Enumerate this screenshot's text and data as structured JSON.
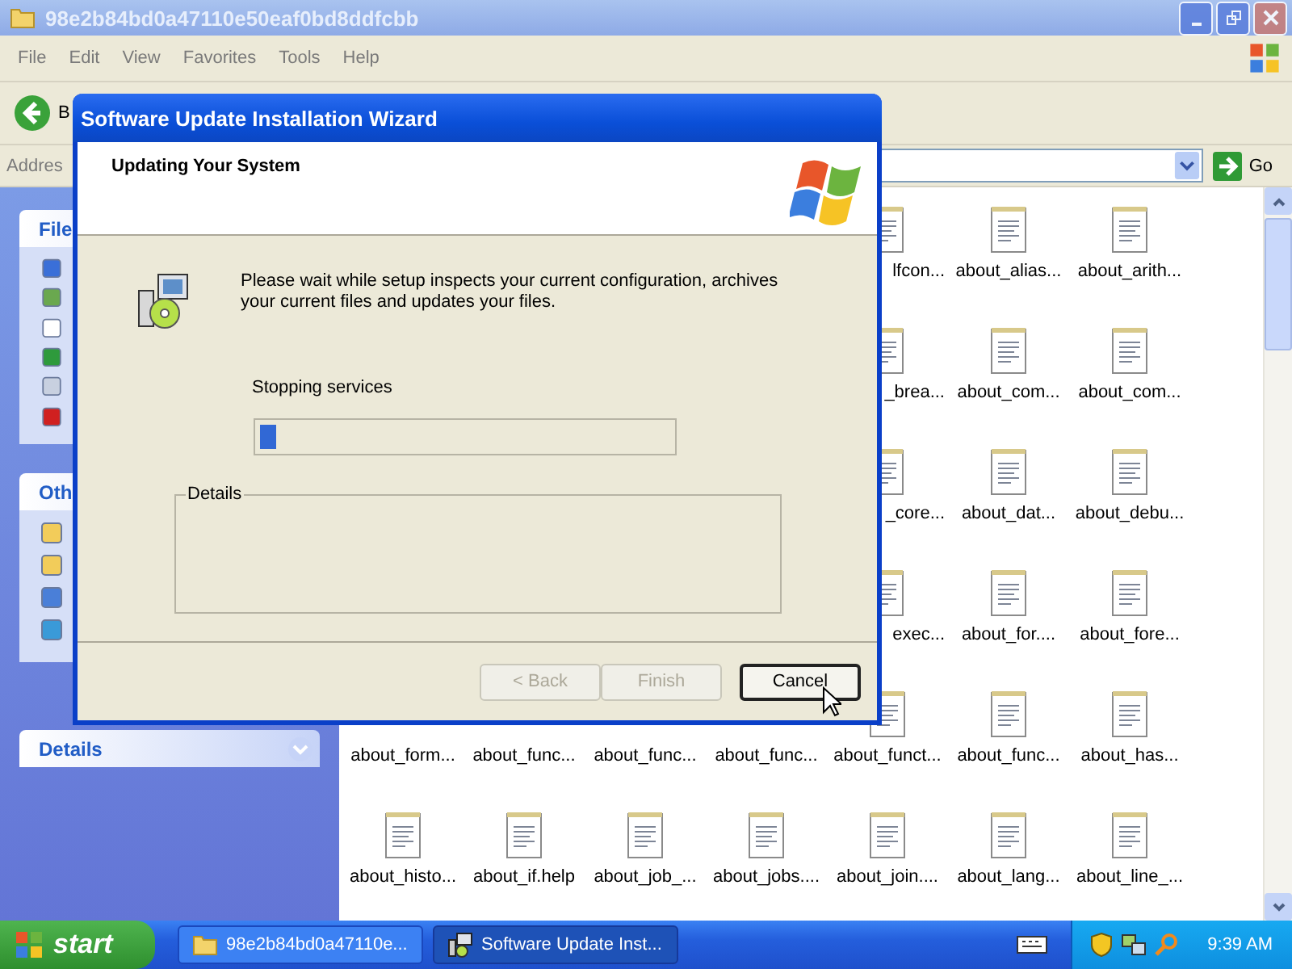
{
  "explorer": {
    "title": "98e2b84bd0a47110e50eaf0bd8ddfcbb",
    "menu": [
      "File",
      "Edit",
      "View",
      "Favorites",
      "Tools",
      "Help"
    ],
    "back_label": "B",
    "address_label": "Addres",
    "go_label": "Go",
    "panes": [
      {
        "kind": "file_tasks",
        "title": "File"
      },
      {
        "kind": "other_places",
        "title": "Oth"
      },
      {
        "kind": "details",
        "title": "Details",
        "expanded": false
      }
    ],
    "file_rows": [
      [
        {
          "kind": "clipped",
          "label": "lfcon..."
        },
        {
          "kind": "file",
          "label": "about_alias..."
        },
        {
          "kind": "file",
          "label": "about_arith..."
        }
      ],
      [
        {
          "kind": "clipped",
          "label": "_brea..."
        },
        {
          "kind": "file",
          "label": "about_com..."
        },
        {
          "kind": "file",
          "label": "about_com..."
        }
      ],
      [
        {
          "kind": "clipped",
          "label": "_core..."
        },
        {
          "kind": "file",
          "label": "about_dat..."
        },
        {
          "kind": "file",
          "label": "about_debu..."
        }
      ],
      [
        {
          "kind": "clipped",
          "label": "exec..."
        },
        {
          "kind": "file",
          "label": "about_for...."
        },
        {
          "kind": "file",
          "label": "about_fore..."
        }
      ],
      [
        {
          "kind": "label_only",
          "label": "about_form..."
        },
        {
          "kind": "label_only",
          "label": "about_func..."
        },
        {
          "kind": "label_only",
          "label": "about_func..."
        },
        {
          "kind": "label_only",
          "label": "about_func..."
        },
        {
          "kind": "file",
          "label": "about_funct..."
        },
        {
          "kind": "file",
          "label": "about_func..."
        },
        {
          "kind": "file",
          "label": "about_has..."
        }
      ],
      [
        {
          "kind": "file",
          "label": "about_histo..."
        },
        {
          "kind": "file",
          "label": "about_if.help"
        },
        {
          "kind": "file",
          "label": "about_job_..."
        },
        {
          "kind": "file",
          "label": "about_jobs...."
        },
        {
          "kind": "file",
          "label": "about_join...."
        },
        {
          "kind": "file",
          "label": "about_lang..."
        },
        {
          "kind": "file",
          "label": "about_line_..."
        }
      ]
    ]
  },
  "dialog": {
    "title": "Software Update Installation Wizard",
    "header_title": "Updating Your System",
    "message": "Please wait while setup inspects your current configuration, archives your current files and updates your files.",
    "status": "Stopping services",
    "progress": {
      "level": 0.04
    },
    "group_label": "Details",
    "buttons": [
      {
        "label": "< Back",
        "disabled": true,
        "default": false
      },
      {
        "label": "Finish",
        "disabled": true,
        "default": false
      },
      {
        "label": "Cancel",
        "disabled": false,
        "default": true
      }
    ]
  },
  "taskbar": {
    "start_label": "start",
    "tasks": [
      {
        "kind": "folder",
        "label": "98e2b84bd0a47110e...",
        "selected": false
      },
      {
        "kind": "setup",
        "label": "Software Update Inst...",
        "selected": true
      }
    ],
    "clock": "9:39 AM"
  }
}
